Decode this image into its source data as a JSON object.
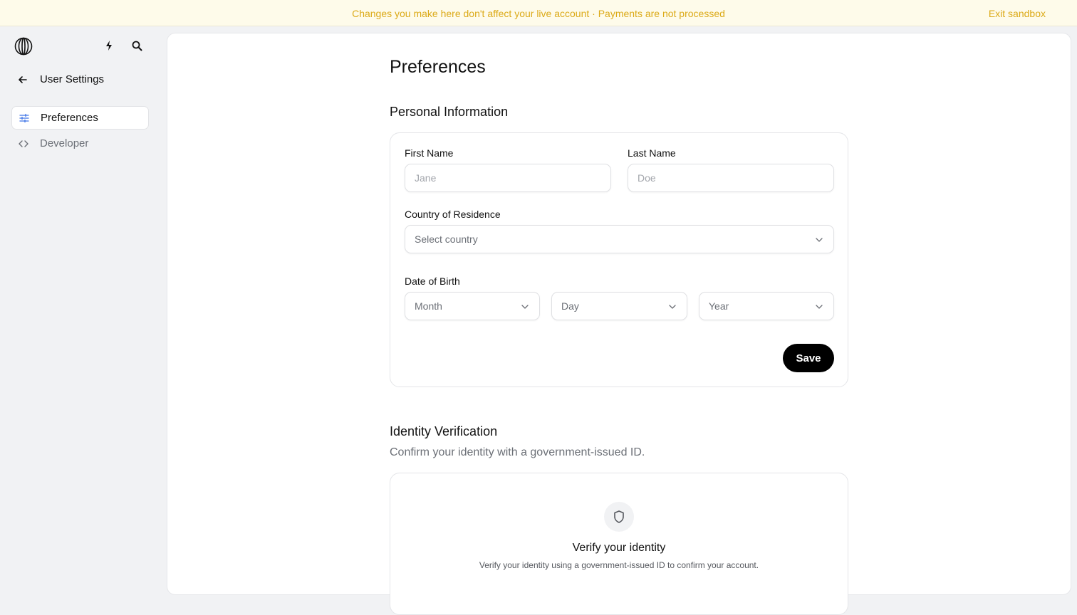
{
  "banner": {
    "message": "Changes you make here don't affect your live account · Payments are not processed",
    "exit_label": "Exit sandbox",
    "color": "#dcaa18"
  },
  "sidebar": {
    "logo_icon": "globe-logo-icon",
    "back_label": "User Settings",
    "items": [
      {
        "label": "Preferences",
        "icon": "sliders-icon",
        "active": true
      },
      {
        "label": "Developer",
        "icon": "code-icon",
        "active": false
      }
    ]
  },
  "main": {
    "title": "Preferences",
    "personal": {
      "heading": "Personal Information",
      "first_name_label": "First Name",
      "first_name_placeholder": "Jane",
      "last_name_label": "Last Name",
      "last_name_placeholder": "Doe",
      "country_label": "Country of Residence",
      "country_placeholder": "Select country",
      "dob_label": "Date of Birth",
      "month_placeholder": "Month",
      "day_placeholder": "Day",
      "year_placeholder": "Year",
      "save_label": "Save"
    },
    "identity": {
      "heading": "Identity Verification",
      "description": "Confirm your identity with a government-issued ID.",
      "card_title": "Verify your identity",
      "card_subtitle": "Verify your identity using a government-issued ID to confirm your account."
    }
  }
}
